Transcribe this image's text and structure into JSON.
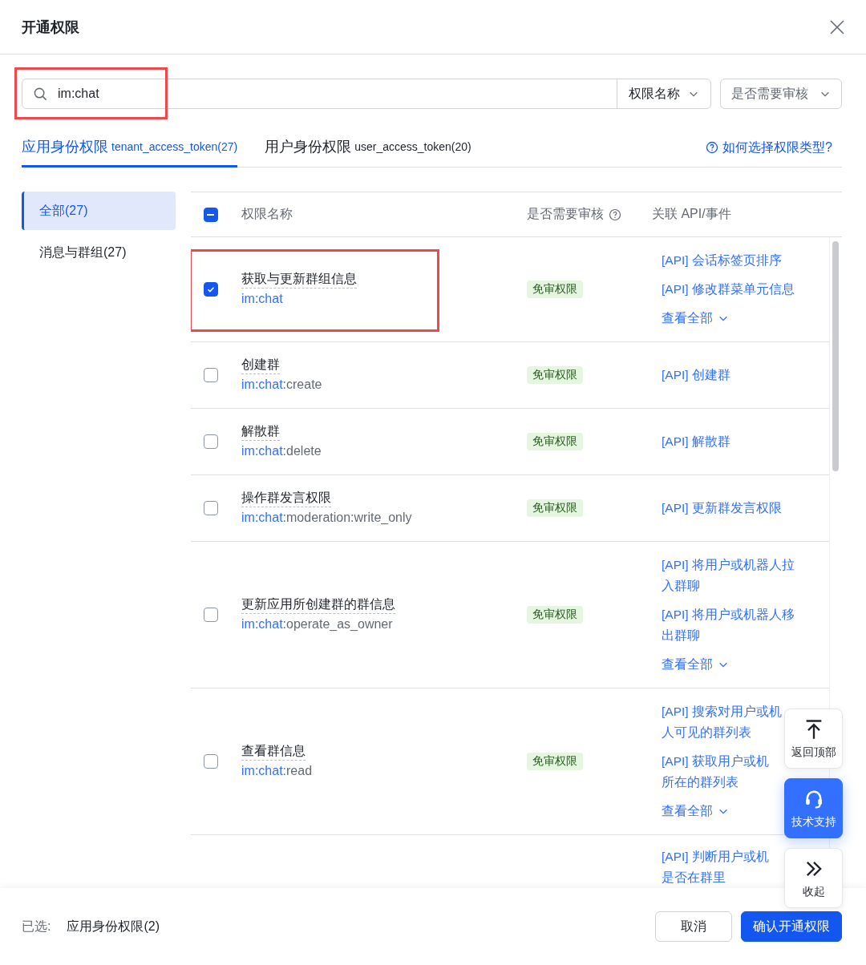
{
  "dialog": {
    "title": "开通权限"
  },
  "search": {
    "value": "im:chat",
    "highlighted": true,
    "field_select": "权限名称",
    "review_select": "是否需要审核"
  },
  "tabs": [
    {
      "label": "应用身份权限",
      "token": "tenant_access_token(27)",
      "selected": true
    },
    {
      "label": "用户身份权限",
      "token": "user_access_token(20)",
      "selected": false
    }
  ],
  "help_link": "如何选择权限类型?",
  "sidebar": {
    "items": [
      {
        "label": "全部(27)",
        "selected": true
      },
      {
        "label": "消息与群组(27)",
        "selected": false
      }
    ]
  },
  "table": {
    "select_all": {
      "indeterminate": true
    },
    "columns": [
      "权限名称",
      "是否需要审核",
      "关联 API/事件"
    ],
    "rows": [
      {
        "kind": "full",
        "checked": true,
        "highlighted": true,
        "name": "获取与更新群组信息",
        "scope": "im:chat",
        "scope_rest": "",
        "badge": "免审权限",
        "apis": [
          {
            "lines": [
              "[API] 会话标签页排序"
            ]
          },
          {
            "lines": [
              "[API] 修改群菜单元信息"
            ]
          }
        ],
        "more": "查看全部"
      },
      {
        "kind": "full",
        "checked": false,
        "highlighted": false,
        "name": "创建群",
        "scope": "im:chat",
        "scope_rest": ":create",
        "badge": "免审权限",
        "apis": [
          {
            "lines": [
              "[API] 创建群"
            ]
          }
        ]
      },
      {
        "kind": "full",
        "checked": false,
        "highlighted": false,
        "name": "解散群",
        "scope": "im:chat",
        "scope_rest": ":delete",
        "badge": "免审权限",
        "apis": [
          {
            "lines": [
              "[API] 解散群"
            ]
          }
        ]
      },
      {
        "kind": "full",
        "checked": false,
        "highlighted": false,
        "name": "操作群发言权限",
        "scope": "im:chat",
        "scope_rest": ":moderation:write_only",
        "badge": "免审权限",
        "apis": [
          {
            "lines": [
              "[API] 更新群发言权限"
            ]
          }
        ]
      },
      {
        "kind": "full",
        "checked": false,
        "highlighted": false,
        "name": "更新应用所创建群的群信息",
        "scope": "im:chat",
        "scope_rest": ":operate_as_owner",
        "badge": "免审权限",
        "apis": [
          {
            "lines": [
              "[API] 将用户或机器人拉",
              "入群聊"
            ]
          },
          {
            "lines": [
              "[API] 将用户或机器人移",
              "出群聊"
            ]
          }
        ],
        "more": "查看全部"
      },
      {
        "kind": "full",
        "checked": false,
        "highlighted": false,
        "name": "查看群信息",
        "scope": "im:chat",
        "scope_rest": ":read",
        "badge": "免审权限",
        "apis": [
          {
            "lines": [
              "[API] 搜索对用户或机",
              "人可见的群列表"
            ]
          },
          {
            "lines": [
              "[API] 获取用户或机",
              "所在的群列表"
            ]
          }
        ],
        "more": "查看全部"
      },
      {
        "kind": "partial",
        "apis": [
          {
            "lines": [
              "[API] 判断用户或机",
              "是否在群里"
            ]
          }
        ]
      }
    ]
  },
  "float_buttons": [
    {
      "kind": "top",
      "label": "返回顶部"
    },
    {
      "kind": "support",
      "label": "技术支持"
    },
    {
      "kind": "collapse",
      "label": "收起"
    }
  ],
  "footer": {
    "selected_label": "已选:",
    "selected_value": "应用身份权限(2)",
    "buttons": [
      {
        "kind": "secondary",
        "label": "取消"
      },
      {
        "kind": "primary",
        "label": "确认开通权限"
      }
    ]
  }
}
